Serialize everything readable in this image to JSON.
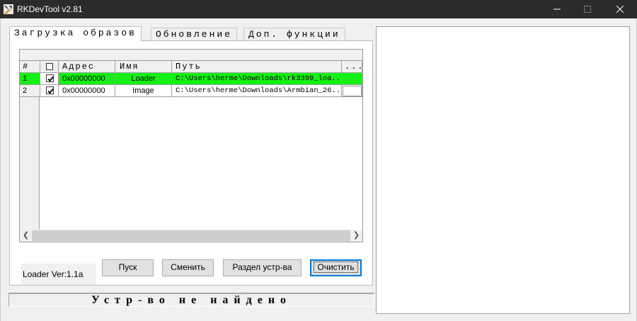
{
  "window": {
    "title": "RKDevTool v2.81",
    "icon": "rk-tool-icon"
  },
  "tabs": [
    {
      "label": "Загрузка образов",
      "active": true
    },
    {
      "label": "Обновление",
      "active": false
    },
    {
      "label": "Доп. функции",
      "active": false
    }
  ],
  "grid": {
    "columns": [
      "#",
      "",
      "Адрес",
      "Имя",
      "Путь",
      "..."
    ],
    "rows": [
      {
        "index": "1",
        "checked": true,
        "address": "0x00000000",
        "name": "Loader",
        "path": "C:\\Users\\herme\\Downloads\\rk3399_loa...",
        "selected": true
      },
      {
        "index": "2",
        "checked": true,
        "address": "0x00000000",
        "name": "Image",
        "path": "C:\\Users\\herme\\Downloads\\Armbian_26...",
        "selected": false
      }
    ]
  },
  "loader_version": "Loader Ver:1.1a",
  "buttons": {
    "run": "Пуск",
    "switch": "Сменить",
    "partition": "Раздел устр-ва",
    "clear": "Очистить"
  },
  "status": "Устр-во не найдено",
  "colors": {
    "selected_row": "#14f014",
    "title_bar": "#2b2b2b",
    "default_button_border": "#0078d7"
  }
}
